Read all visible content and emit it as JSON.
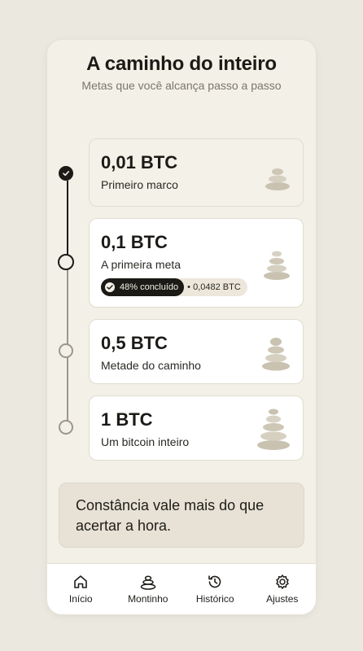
{
  "header": {
    "title": "A caminho do inteiro",
    "subtitle": "Metas que você alcança passo a passo"
  },
  "goals": [
    {
      "amount": "0,01 BTC",
      "label": "Primeiro marco",
      "status": "done",
      "stones": 3
    },
    {
      "amount": "0,1 BTC",
      "label": "A primeira meta",
      "status": "current",
      "stones": 4,
      "progress_label": "48% concluído",
      "progress_value": "0,0482 BTC",
      "progress_percent": 48
    },
    {
      "amount": "0,5 BTC",
      "label": "Metade do caminho",
      "status": "upcoming",
      "stones": 4
    },
    {
      "amount": "1 BTC",
      "label": "Um bitcoin inteiro",
      "status": "upcoming",
      "stones": 5
    }
  ],
  "quote": "Constância vale mais do que acertar a hora.",
  "nav": [
    {
      "label": "Início",
      "icon": "home-icon"
    },
    {
      "label": "Montinho",
      "icon": "stones-icon"
    },
    {
      "label": "Histórico",
      "icon": "history-icon"
    },
    {
      "label": "Ajustes",
      "icon": "gear-icon"
    }
  ],
  "colors": {
    "accent": "#1c1a16",
    "background": "#f3f0e7",
    "stone": "#c9c2b1"
  }
}
